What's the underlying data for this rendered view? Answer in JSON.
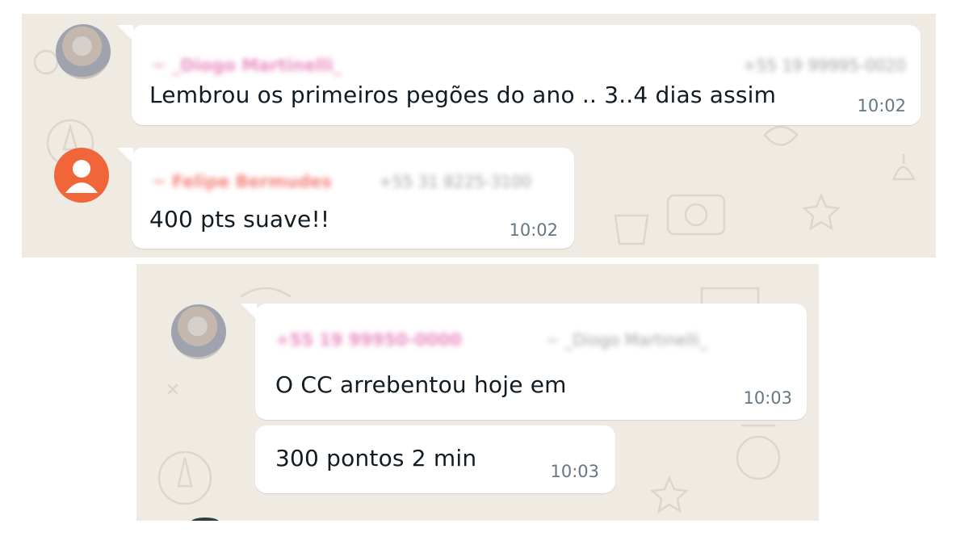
{
  "messages": [
    {
      "sender": "~ _Diogo Martinelli_",
      "phone": "+55 19 99995-0020",
      "text": "Lembrou os primeiros pegões do ano .. 3..4 dias assim",
      "time": "10:02"
    },
    {
      "sender": "~ Felipe Bermudes",
      "phone": "+55 31 8225-3100",
      "text": "400 pts suave!!",
      "time": "10:02"
    },
    {
      "sender": "+55 19 99950-0000",
      "phone": "~ _Diogo Martinelli_",
      "text": "O CC arrebentou hoje em",
      "time": "10:03"
    },
    {
      "text": "300 pontos 2 min",
      "time": "10:03"
    }
  ],
  "colors": {
    "wallpaper": "#efeae2",
    "bubble": "#ffffff",
    "sender_pink": "#e57ab7",
    "sender_salmon": "#f06f66",
    "default_avatar": "#f0653a",
    "timestamp": "#667781"
  },
  "icons": {
    "default_avatar": "person-silhouette-icon"
  }
}
